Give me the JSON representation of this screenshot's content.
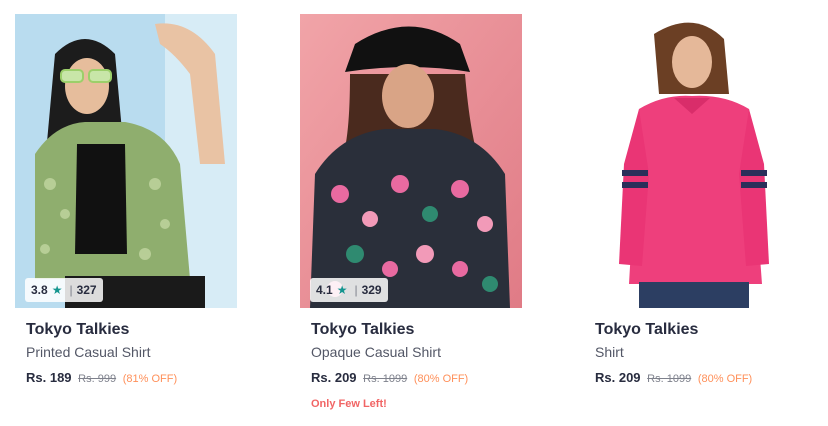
{
  "products": [
    {
      "brand": "Tokyo Talkies",
      "name": "Printed Casual Shirt",
      "price": "Rs. 189",
      "mrp": "Rs. 999",
      "discount": "(81% OFF)",
      "rating": "3.8",
      "rating_count": "327",
      "stock_note": ""
    },
    {
      "brand": "Tokyo Talkies",
      "name": "Opaque Casual Shirt",
      "price": "Rs. 209",
      "mrp": "Rs. 1099",
      "discount": "(80% OFF)",
      "rating": "4.1",
      "rating_count": "329",
      "stock_note": "Only Few Left!"
    },
    {
      "brand": "Tokyo Talkies",
      "name": "Shirt",
      "price": "Rs. 209",
      "mrp": "Rs. 1099",
      "discount": "(80% OFF)",
      "rating": "",
      "rating_count": "",
      "stock_note": ""
    }
  ],
  "colors": {
    "rating_star": "#14958f",
    "discount": "#ff905a",
    "stock_note": "#f16565"
  }
}
